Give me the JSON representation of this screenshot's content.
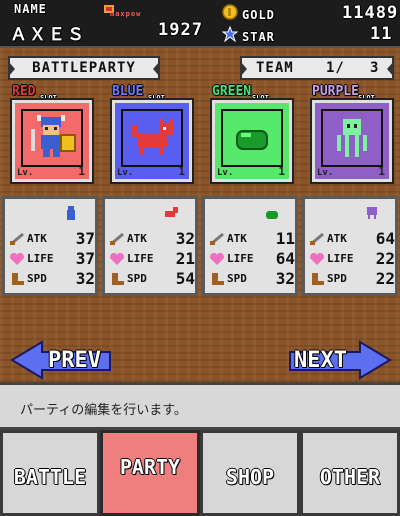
{
  "header": {
    "name_label": "NAME",
    "name_value": "ＡＸＥＳ",
    "maxpow_label": "maxpow",
    "maxpow_value": "1927",
    "gold_label": "GOLD",
    "gold_value": "11489",
    "star_label": "STAR",
    "star_value": "11"
  },
  "banners": {
    "battleparty": "BATTLEPARTY",
    "team_label": "TEAM",
    "team_current": "1/",
    "team_total": "3"
  },
  "slots": [
    {
      "color_label": "RED",
      "slot_tag": "SLOT",
      "lv_label": "Lv.",
      "lv_value": "1",
      "label_color": "#e33b3b",
      "bg": "#f26a6a"
    },
    {
      "color_label": "BLUE",
      "slot_tag": "SLOT",
      "lv_label": "Lv.",
      "lv_value": "1",
      "label_color": "#6e7cff",
      "bg": "#5a5ef0"
    },
    {
      "color_label": "GREEN",
      "slot_tag": "SLOT",
      "lv_label": "Lv.",
      "lv_value": "1",
      "label_color": "#4fe07a",
      "bg": "#55e86a"
    },
    {
      "color_label": "PURPLE",
      "slot_tag": "SLOT",
      "lv_label": "Lv.",
      "lv_value": "1",
      "label_color": "#c6a0e8",
      "bg": "#8e5fc6"
    }
  ],
  "stats": [
    {
      "atk": "37",
      "life": "37",
      "spd": "32"
    },
    {
      "atk": "32",
      "life": "21",
      "spd": "54"
    },
    {
      "atk": "11",
      "life": "64",
      "spd": "32"
    },
    {
      "atk": "64",
      "life": "22",
      "spd": "22"
    }
  ],
  "stat_labels": {
    "atk": "ATK",
    "life": "LIFE",
    "spd": "SPD"
  },
  "nav": {
    "prev": "PREV",
    "next": "NEXT"
  },
  "message": "パーティの編集を行います。",
  "tabs": [
    {
      "label": "BATTLE"
    },
    {
      "label": "PARTY"
    },
    {
      "label": "SHOP"
    },
    {
      "label": "OTHER"
    }
  ],
  "colors": {
    "accent_arrow": "#5b6ff0",
    "active_tab": "#ef7f7f",
    "gold": "#f0c020",
    "star": "#4a6af0",
    "heart": "#f070c0"
  },
  "icons": {
    "gold": "gold-coin-icon",
    "star": "star-icon",
    "maxpow": "maxpow-icon",
    "atk": "sword-icon",
    "life": "heart-icon",
    "spd": "boot-icon"
  }
}
